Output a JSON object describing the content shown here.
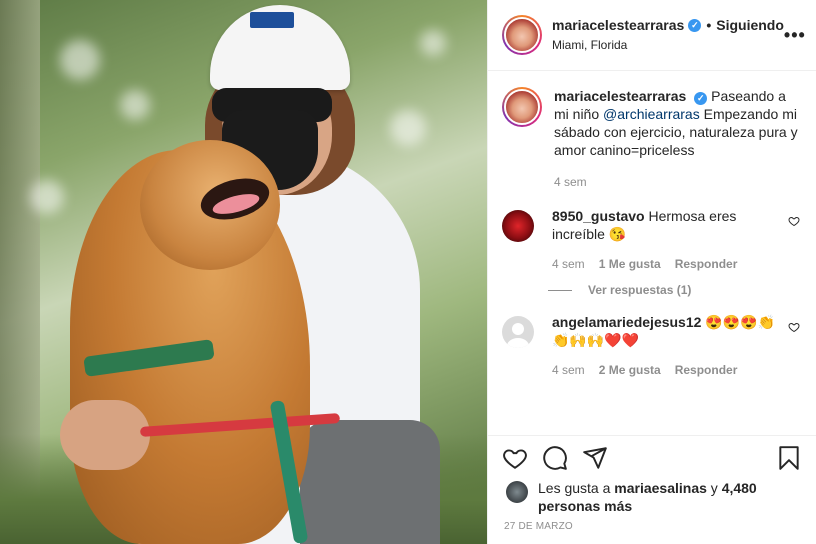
{
  "post": {
    "author": "mariacelestearraras",
    "follow_status": "Siguiendo",
    "separator": "•",
    "location": "Miami, Florida",
    "more_label": "•••",
    "verified_mark": "✓"
  },
  "caption": {
    "username": "mariacelestearraras",
    "text_before": "Paseando a mi niño ",
    "mention": "@archiearraras",
    "text_after": " Empezando mi sábado con ejercicio, naturaleza pura y amor canino=priceless",
    "time": "4 sem"
  },
  "comments": [
    {
      "username": "8950_gustavo",
      "text": "Hermosa eres increíble 😘",
      "time": "4 sem",
      "likes": "1 Me gusta",
      "reply_label": "Responder"
    },
    {
      "username": "angelamariedejesus12",
      "text": "😍😍😍👏👏🙌🙌❤️❤️",
      "time": "4 sem",
      "likes": "2 Me gusta",
      "reply_label": "Responder"
    }
  ],
  "view_replies": "Ver respuestas (1)",
  "likes_summary": {
    "prefix": "Les gusta a ",
    "user": "mariaesalinas",
    "middle": " y ",
    "count_text": "4,480 personas más"
  },
  "date": "27 DE MARZO",
  "colors": {
    "verified": "#3897f0",
    "mention": "#00376b",
    "secondary_text": "#8e8e8e"
  },
  "icons": [
    "heart-icon",
    "comment-icon",
    "share-icon",
    "bookmark-icon",
    "more-icon"
  ]
}
